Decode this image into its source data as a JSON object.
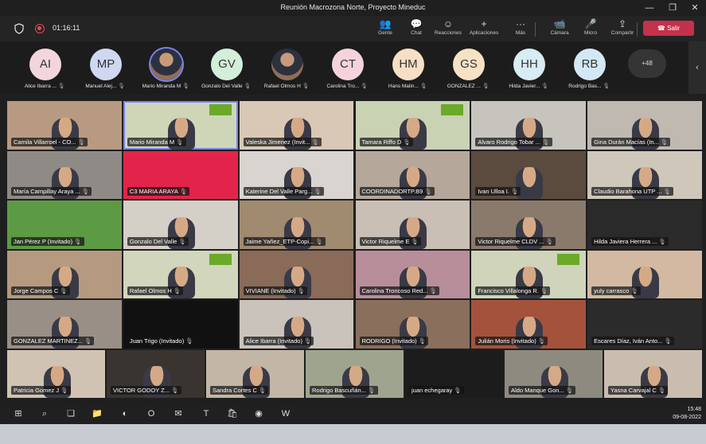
{
  "window": {
    "title": "Reunión Macrozona Norte, Proyecto Mineduc",
    "controls": [
      "—",
      "❐",
      "✕"
    ]
  },
  "callbar": {
    "timer": "01:16:11",
    "tools": [
      {
        "icon": "people-icon",
        "glyph": "👥",
        "label": "Gente"
      },
      {
        "icon": "chat-icon",
        "glyph": "💬",
        "label": "Chat"
      },
      {
        "icon": "reactions-icon",
        "glyph": "☺",
        "label": "Reacciones"
      },
      {
        "icon": "apps-icon",
        "glyph": "+",
        "label": "Aplicaciones"
      },
      {
        "icon": "more-icon",
        "glyph": "···",
        "label": "Más"
      },
      {
        "icon": "camera-icon",
        "glyph": "📹",
        "label": "Cámara"
      },
      {
        "icon": "mic-icon",
        "glyph": "🎤",
        "label": "Micro"
      },
      {
        "icon": "share-icon",
        "glyph": "⇪",
        "label": "Compartir"
      }
    ],
    "leave_label": "Salir",
    "leave_color": "#c4314b"
  },
  "participants": [
    {
      "initials": "AI",
      "name": "Alice Ibarra ...",
      "color": "#f3d6dc"
    },
    {
      "initials": "MP",
      "name": "Manuel Alej...",
      "color": "#cfd8f0"
    },
    {
      "initials": "",
      "name": "Mario Miranda M",
      "color": "photo",
      "selected": true
    },
    {
      "initials": "GV",
      "name": "Gonzalo Del Valle",
      "color": "#d4efd9"
    },
    {
      "initials": "",
      "name": "Rafael Olmos H",
      "color": "photo"
    },
    {
      "initials": "CT",
      "name": "Carolina Tro...",
      "color": "#f5d3dc"
    },
    {
      "initials": "HM",
      "name": "Hans Malin...",
      "color": "#f6dfc5"
    },
    {
      "initials": "GS",
      "name": "GONZALEZ ...",
      "color": "#f8e2c6"
    },
    {
      "initials": "HH",
      "name": "Hilda Javier...",
      "color": "#d7ecf3"
    },
    {
      "initials": "RB",
      "name": "Rodrigo Bas...",
      "color": "#d3e8f5"
    }
  ],
  "more_count": "+48",
  "grid": [
    [
      {
        "name": "Camila Villarroel - CO...",
        "bg": "#b89a82"
      },
      {
        "name": "Mario Miranda M",
        "bg": "#cfd6b8",
        "active": true,
        "logo": true
      },
      {
        "name": "Valeska Jimenez (Invit...",
        "bg": "#d8c8b5"
      },
      {
        "name": "Tamara Riffo D",
        "bg": "#c9d2b3",
        "logo": true
      },
      {
        "name": "Alvaro Rodrigo Tobar ...",
        "bg": "#c7c4be"
      },
      {
        "name": "Gina Durán Macías (In...",
        "bg": "#bfb9b2"
      }
    ],
    [
      {
        "name": "María Campillay Araya ...",
        "bg": "#8f8a86"
      },
      {
        "name": "C3 MARIA ARAYA",
        "bg": "#e3244a"
      },
      {
        "name": "Katerine Del Valle Parg...",
        "bg": "#d9d4cf"
      },
      {
        "name": "COORDINADORTP.B9",
        "bg": "#b5a79a"
      },
      {
        "name": "Ivan Ulloa I.",
        "bg": "#5b4a3e"
      },
      {
        "name": "Claudio Barahona UTP ...",
        "bg": "#cfc7ba"
      }
    ],
    [
      {
        "name": "Jan Pérez P (Invitado)",
        "bg": "#5d9a44"
      },
      {
        "name": "Gonzalo Del Valle",
        "bg": "#d4d0c8"
      },
      {
        "name": "Jaime Yañez_ETP-Copi...",
        "bg": "#a08a70"
      },
      {
        "name": "Victor Riquelme E",
        "bg": "#c9bfb4"
      },
      {
        "name": "Victor Riquelme CLDV ...",
        "bg": "#8a7a6c"
      },
      {
        "name": "Hilda Javiera Herrera ...",
        "bg": "#2a2a2a"
      }
    ],
    [
      {
        "name": "Jorge Campos C",
        "bg": "#b59a80"
      },
      {
        "name": "Rafael Olmos H",
        "bg": "#d1d6bc",
        "logo": true
      },
      {
        "name": "VIVIANE (Invitado)",
        "bg": "#8a6a58"
      },
      {
        "name": "Carolina Troncoso Red...",
        "bg": "#b88e9a"
      },
      {
        "name": "Francisco Villalonga R.",
        "bg": "#cfd4ba",
        "logo": true
      },
      {
        "name": "yuly carrasco",
        "bg": "#d3b9a2"
      }
    ],
    [
      {
        "name": "GONZALEZ MARTINEZ...",
        "bg": "#9a8f86"
      },
      {
        "name": "Juan Trigo (Invitado)",
        "bg": "#111111"
      },
      {
        "name": "Alice Ibarra (Invitado)",
        "bg": "#c9c3bb"
      },
      {
        "name": "RODRIGO (Invitado)",
        "bg": "#8a6f5c"
      },
      {
        "name": "Julián Moris (Invitado)",
        "bg": "#a5523d"
      },
      {
        "name": "Escares Díaz, Iván Anto...",
        "bg": "#2b2b2b"
      }
    ],
    [
      {
        "name": "Patricia Gomez J",
        "bg": "#d0c3b3"
      },
      {
        "name": "VICTOR GODOY Z...",
        "bg": "#3a3430"
      },
      {
        "name": "Sandra Cortes C",
        "bg": "#c2b6a6"
      },
      {
        "name": "Rodrigo Bascuñán...",
        "bg": "#9fa48e"
      },
      {
        "name": "juan echegaray",
        "bg": "#1c1c1c"
      },
      {
        "name": "Aldo Manque Gon...",
        "bg": "#8e8a7f"
      },
      {
        "name": "Yasna Carvajal C",
        "bg": "#c9bdb0"
      }
    ]
  ],
  "taskbar": {
    "icons": [
      {
        "icon": "windows-start-icon",
        "glyph": "⊞"
      },
      {
        "icon": "search-icon",
        "glyph": "⌕"
      },
      {
        "icon": "task-view-icon",
        "glyph": "❏"
      },
      {
        "icon": "file-explorer-icon",
        "glyph": "📁"
      },
      {
        "icon": "edge-icon",
        "glyph": "◐"
      },
      {
        "icon": "outlook-icon",
        "glyph": "O"
      },
      {
        "icon": "mail-icon",
        "glyph": "✉"
      },
      {
        "icon": "teams-icon",
        "glyph": "T"
      },
      {
        "icon": "store-icon",
        "glyph": "🛍"
      },
      {
        "icon": "firefox-icon",
        "glyph": "◉"
      },
      {
        "icon": "word-icon",
        "glyph": "W"
      }
    ],
    "time": "15:48",
    "date": "09-08-2022"
  }
}
